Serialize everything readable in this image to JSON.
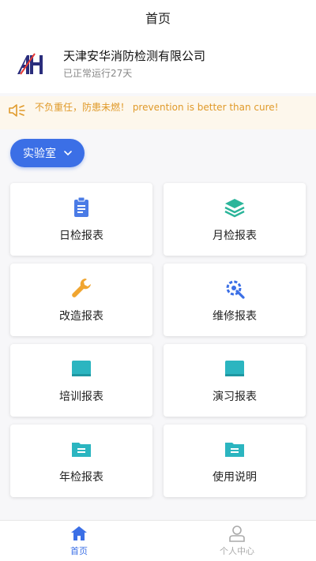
{
  "header": {
    "title": "首页"
  },
  "company": {
    "name": "天津安华消防检测有限公司",
    "status": "已正常运行27天",
    "logo_color": "#2a2d7c"
  },
  "notice": {
    "text": "不负重任，防患未燃！ prevention is better than cure!",
    "icon": "speaker-icon",
    "color": "#e09a2a"
  },
  "filter": {
    "label": "实验室"
  },
  "cards": [
    {
      "label": "日检报表",
      "icon": "clipboard-icon",
      "color": "#4a7be6"
    },
    {
      "label": "月检报表",
      "icon": "layers-icon",
      "color": "#2bb59a"
    },
    {
      "label": "改造报表",
      "icon": "wrench-icon",
      "color": "#f0a530"
    },
    {
      "label": "维修报表",
      "icon": "gear-wrench-icon",
      "color": "#3b6fe6"
    },
    {
      "label": "培训报表",
      "icon": "book-icon",
      "color": "#2bb5c0"
    },
    {
      "label": "演习报表",
      "icon": "book-icon",
      "color": "#2bb5c0"
    },
    {
      "label": "年检报表",
      "icon": "folder-icon",
      "color": "#2bb5c0"
    },
    {
      "label": "使用说明",
      "icon": "folder-icon",
      "color": "#2bb5c0"
    }
  ],
  "tabbar": {
    "home_label": "首页",
    "profile_label": "个人中心",
    "active_color": "#3b6fe6",
    "inactive_color": "#aaaaaa"
  }
}
